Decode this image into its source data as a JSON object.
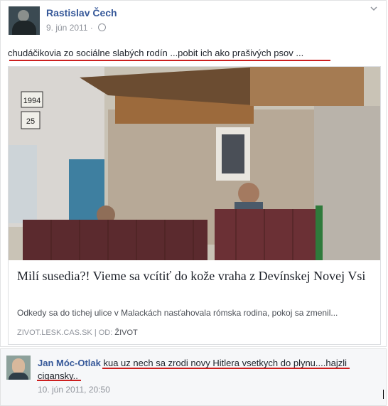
{
  "post": {
    "author": "Rastislav Čech",
    "date": "9. jún 2011",
    "privacy_icon": "globe-icon",
    "menu_icon": "chevron-down-icon",
    "text": "chudáčikovia zo sociálne slabých rodín ...pobit ich ako prašivých psov ..."
  },
  "link_preview": {
    "title": "Milí susedia?! Vieme sa vcítiť do kože vraha z Devínskej Novej Vsi",
    "description": "Odkedy sa do tichej ulice v Malackách nasťahovala rómska rodina, pokoj sa zmenil...",
    "source": "ZIVOT.LESK.CAS.SK",
    "separator": "|",
    "section_prefix": "OD:",
    "section": "ŽIVOT",
    "photo_signs": [
      "1994",
      "25"
    ]
  },
  "comment": {
    "author": "Jan Móc-Otlak",
    "text": "kua uz nech sa zrodi novy Hitlera vsetkych do plynu....hajzli cigansky..",
    "time": "10. jún 2011, 20:50"
  },
  "colors": {
    "link_blue": "#365899",
    "annotation_red": "#cc1f1f",
    "meta_gray": "#90949c"
  }
}
